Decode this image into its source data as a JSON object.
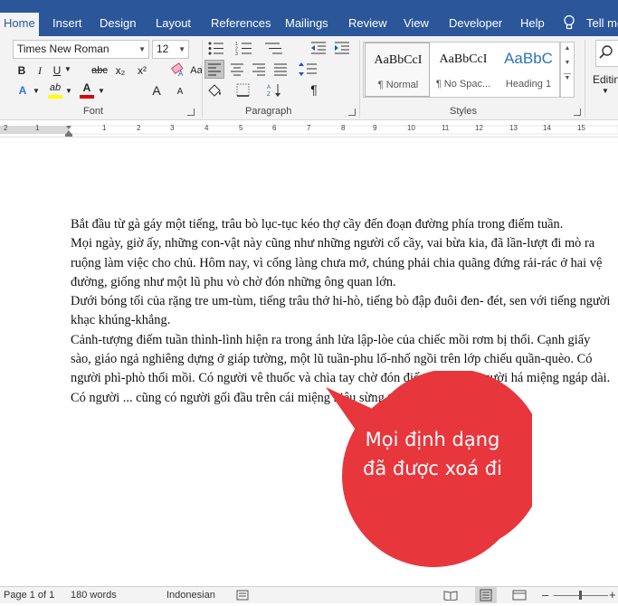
{
  "tabs": [
    "Home",
    "Insert",
    "Design",
    "Layout",
    "References",
    "Mailings",
    "Review",
    "View",
    "Developer",
    "Help",
    "Tell me"
  ],
  "active_tab": "Home",
  "font": {
    "name": "Times New Roman",
    "size": "12",
    "group_label": "Font",
    "bold": "B",
    "italic": "I",
    "underline": "U",
    "strike": "abc",
    "subscript": "x₂",
    "superscript": "x²",
    "grow": "A",
    "shrink": "A",
    "case": "Aa",
    "text_effects_icon": "A",
    "highlight_icon": "ab",
    "font_color_icon": "A"
  },
  "paragraph": {
    "group_label": "Paragraph",
    "pilcrow": "¶"
  },
  "styles": {
    "group_label": "Styles",
    "items": [
      {
        "sample": "AaBbCcI",
        "name": "¶ Normal"
      },
      {
        "sample": "AaBbCcI",
        "name": "¶ No Spac..."
      },
      {
        "sample": "AaBbC",
        "name": "Heading 1"
      }
    ]
  },
  "editing": {
    "label": "Editin"
  },
  "ruler": {
    "numbers": [
      "2",
      "1",
      "1",
      "2",
      "3",
      "4",
      "5",
      "6",
      "7",
      "8",
      "9",
      "10",
      "11",
      "12",
      "13",
      "14",
      "15"
    ]
  },
  "document": {
    "paragraphs": [
      "Bắt đầu từ gà gáy một tiếng, trâu bò lục-tục kéo thợ cầy đến đoạn đường phía trong điếm tuần.",
      "Mọi ngày, giờ ấy, những con-vật này cũng như những người cổ cầy, vai bừa kia, đã lần-lượt đi mò ra ruộng làm việc cho chủ. Hôm nay, vì cổng làng chưa mở, chúng phải chia quãng đứng rải-rác ở hai vệ đường, giống như một lũ phu vò chờ đón những ông quan lớn.",
      "Dưới bóng tối của rặng tre um-tùm, tiếng trâu thở hi-hò, tiếng bò đập đuôi đen- đét, sen với tiếng người khạc khúng-khắng.",
      "Cảnh-tượng điếm tuần thình-lình hiện ra trong ánh lửa lập-lòe của chiếc mồi rơm bị thổi. Cạnh giấy sào, giáo ngả nghiêng dựng ở giáp tường, một lũ tuần-phu lố-nhố ngồi trên lớp chiếu quần-quèo. Có người phì-phò thổi mồi. Có người vê thuốc và chìa tay chờ đón điếu đóm. Có người há miệng ngáp dài. Có người ... cũng có người gối đầu trên cái miệng hiệu sừng trâu, ngành mặt vào"
    ]
  },
  "callout": {
    "text": "Mọi định dạng đã được xoá đi",
    "fill_color": "#e8363d"
  },
  "status": {
    "page": "Page 1 of 1",
    "words": "180 words",
    "language": "Indonesian"
  },
  "colors": {
    "ribbon_blue": "#2b579a",
    "highlight_yellow": "#ffff00",
    "font_color_red": "#e00000"
  }
}
